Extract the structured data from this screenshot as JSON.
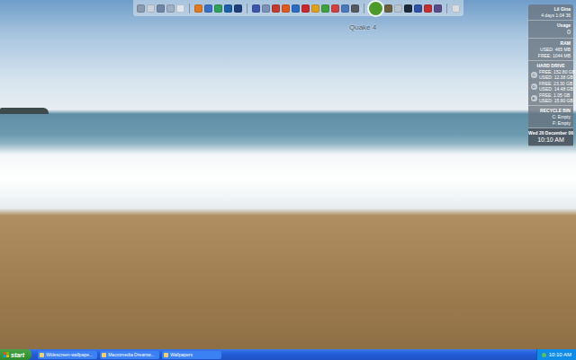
{
  "dock": {
    "tooltip": "Quake 4",
    "groups": [
      {
        "items": [
          {
            "color": "#8a9bb0",
            "selected": false
          },
          {
            "color": "#c9d3de",
            "selected": false
          },
          {
            "color": "#6f86a6",
            "selected": false
          },
          {
            "color": "#9fb0c4",
            "selected": false
          },
          {
            "color": "#dfe6ee",
            "selected": false
          }
        ]
      },
      {
        "items": [
          {
            "color": "#e07a1f",
            "selected": false
          },
          {
            "color": "#3a6fc4",
            "selected": false
          },
          {
            "color": "#2f9e5a",
            "selected": false
          },
          {
            "color": "#1b5fa8",
            "selected": false
          },
          {
            "color": "#1f3f7a",
            "selected": false
          }
        ]
      },
      {
        "items": [
          {
            "color": "#3b56a8",
            "selected": false
          },
          {
            "color": "#7c8fb8",
            "selected": false
          },
          {
            "color": "#c23b2e",
            "selected": false
          },
          {
            "color": "#e05a20",
            "selected": false
          },
          {
            "color": "#2b6cc0",
            "selected": false
          },
          {
            "color": "#c7282c",
            "selected": false
          },
          {
            "color": "#e0a020",
            "selected": false
          },
          {
            "color": "#3fa040",
            "selected": false
          },
          {
            "color": "#d04040",
            "selected": false
          },
          {
            "color": "#4a78b8",
            "selected": false
          },
          {
            "color": "#555a60",
            "selected": false
          }
        ]
      },
      {
        "items": [
          {
            "color": "#4c9a2a",
            "selected": true
          },
          {
            "color": "#6a6040",
            "selected": false
          },
          {
            "color": "#b8c4d0",
            "selected": false
          },
          {
            "color": "#1c2a3a",
            "selected": false
          },
          {
            "color": "#3050a0",
            "selected": false
          },
          {
            "color": "#c03030",
            "selected": false
          },
          {
            "color": "#5a4a8a",
            "selected": false
          }
        ]
      },
      {
        "items": [
          {
            "color": "#d8dde4",
            "selected": false
          }
        ]
      }
    ]
  },
  "sidebar": {
    "sections": [
      {
        "kind": "text",
        "title": "Lil Gina",
        "lines": [
          "4 days 1:04 36"
        ]
      },
      {
        "kind": "text",
        "title": "Usage",
        "lines": [
          "0"
        ]
      },
      {
        "kind": "text",
        "title": "RAM",
        "lines": [
          "USED: 465 MB",
          "FREE: 1044 MB"
        ]
      },
      {
        "kind": "drive",
        "title": "HARD DRIVE",
        "drives": [
          {
            "letter": "C:",
            "lines": [
              "FREE: 152.80 GB",
              "USED: 12.38 GB"
            ]
          },
          {
            "letter": "D:",
            "lines": [
              "FREE: 23.30 GB",
              "USED: 14.48 GB"
            ]
          },
          {
            "letter": "E:",
            "lines": [
              "FREE: 1.05 GB",
              "USED: 15.90 GB"
            ]
          }
        ]
      },
      {
        "kind": "text",
        "title": "RECYCLE BIN",
        "lines": [
          "C: Empty",
          "F: Empty"
        ]
      },
      {
        "kind": "clock",
        "title": "Wed 20 December 06",
        "lines": [
          "10:10 AM"
        ]
      }
    ]
  },
  "taskbar": {
    "start": "start",
    "tasks": [
      {
        "label": "Widescreen-wallpape...",
        "selected": false
      },
      {
        "label": "Macromedia Dreamw...",
        "selected": false
      },
      {
        "label": "Wallpapers",
        "selected": false
      }
    ],
    "clock": "10:10 AM"
  }
}
